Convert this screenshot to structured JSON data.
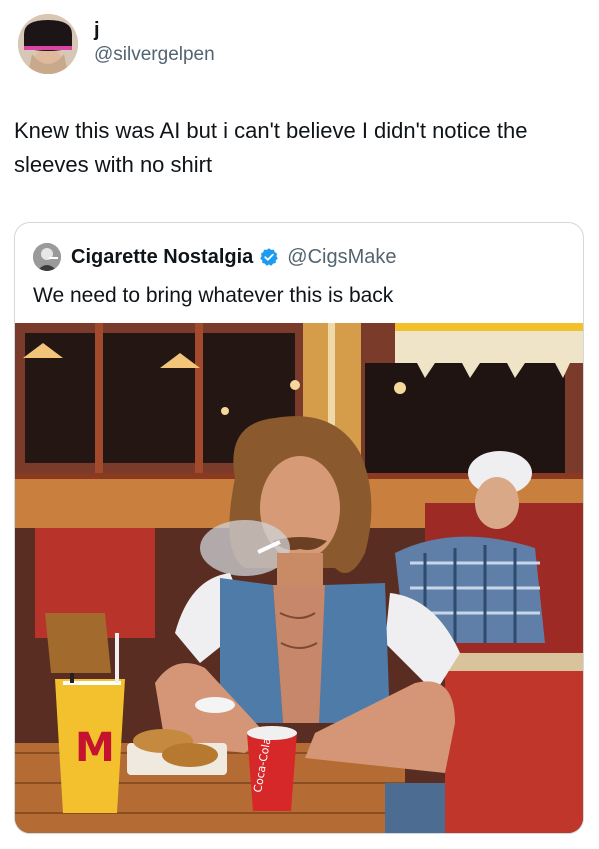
{
  "tweet": {
    "author": {
      "display_name": "j",
      "handle": "@silvergelpen",
      "avatar_icon": "user-avatar-icon"
    },
    "text": "Knew this was AI but i can't believe I didn't notice the sleeves with no shirt"
  },
  "quoted_tweet": {
    "author": {
      "display_name": "Cigarette Nostalgia",
      "handle": "@CigsMake",
      "verified": true,
      "verified_color": "#1d9bf0",
      "avatar_icon": "quoted-user-avatar-icon"
    },
    "text": "We need to bring whatever this is back",
    "media": {
      "kind": "photo",
      "cup_brand_text": "Coca-Cola",
      "fries_logo_text": "M"
    }
  }
}
